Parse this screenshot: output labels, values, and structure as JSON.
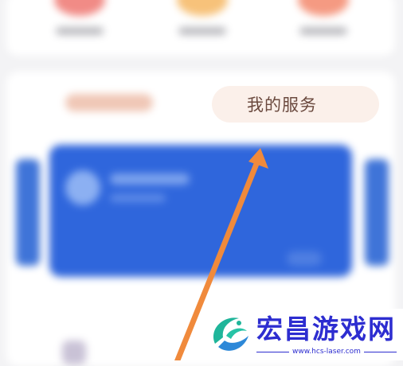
{
  "services": {
    "tab_my_services": "我的服务"
  },
  "watermark": {
    "title": "宏昌游戏网",
    "url": "www.hcs-laser.com"
  },
  "colors": {
    "banner_blue": "#2f66dc",
    "arrow_orange": "#f08a3c",
    "tab_text": "#6b4a3f",
    "watermark_blue": "#2d2dd0"
  }
}
